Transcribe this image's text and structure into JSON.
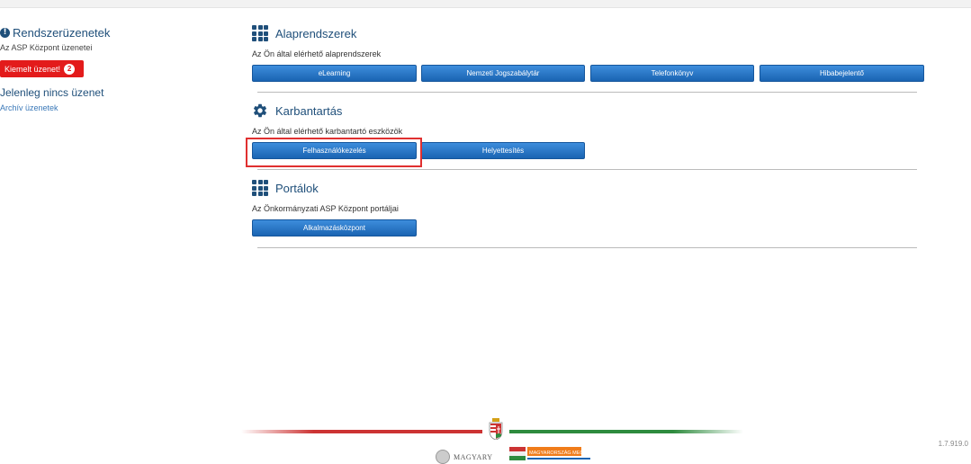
{
  "sidebar": {
    "title": "Rendszerüzenetek",
    "subtitle": "Az ASP Központ üzenetei",
    "highlighted_button": "Kiemelt üzenet!",
    "highlighted_count": "2",
    "no_message": "Jelenleg nincs üzenet",
    "archive_link": "Archív üzenetek"
  },
  "sections": {
    "alaprendszerek": {
      "title": "Alaprendszerek",
      "description": "Az Ön által elérhető alaprendszerek",
      "buttons": [
        "eLearning",
        "Nemzeti Jogszabálytár",
        "Telefonkönyv",
        "Hibabejelentő"
      ]
    },
    "karbantartas": {
      "title": "Karbantartás",
      "description": "Az Ön által elérhető karbantartó eszközök",
      "buttons": [
        "Felhasználókezelés",
        "Helyettesítés"
      ]
    },
    "portalok": {
      "title": "Portálok",
      "description": "Az Önkormányzati ASP Központ portáljai",
      "buttons": [
        "Alkalmazásközpont"
      ]
    }
  },
  "footer": {
    "logo_left_text": "MAGYARY",
    "logo_right_text": "MAGYARORSZÁG MEGÚJUL",
    "version": "1.7.919.0"
  },
  "colors": {
    "primary_blue": "#1a64b2",
    "heading_blue": "#1f4f7a",
    "alert_red": "#e31b1b",
    "highlight_red": "#e03030"
  },
  "icons": {
    "section_alaprendszerek": "grid-icon",
    "section_karbantartas": "gear-icon",
    "section_portalok": "grid-icon",
    "sidebar_title": "info-icon"
  }
}
